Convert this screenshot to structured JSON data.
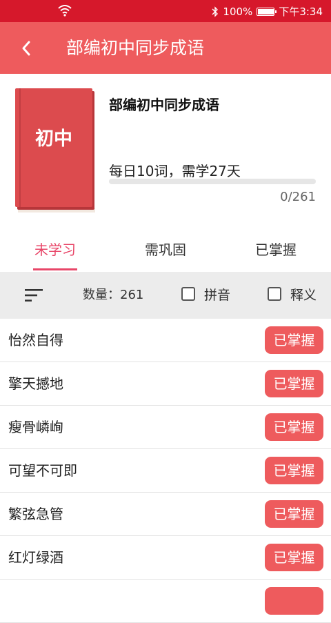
{
  "status_bar": {
    "battery_percent": "100%",
    "battery_level": 1.0,
    "time": "下午3:34"
  },
  "header": {
    "title": "部编初中同步成语"
  },
  "book": {
    "cover_text": "初中",
    "name": "部编初中同步成语",
    "plan": "每日10词，需学27天",
    "progress_label": "0/261",
    "progress_fraction": 0
  },
  "tabs": [
    {
      "label": "未学习",
      "active": true
    },
    {
      "label": "需巩固",
      "active": false
    },
    {
      "label": "已掌握",
      "active": false
    }
  ],
  "filter": {
    "count_label": "数量：261",
    "pinyin_label": "拼音",
    "pinyin_checked": false,
    "meaning_label": "释义",
    "meaning_checked": false
  },
  "list": {
    "button_label": "已掌握",
    "items": [
      "怡然自得",
      "擎天撼地",
      "瘦骨嶙峋",
      "可望不可即",
      "繁弦急管",
      "红灯绿酒",
      ""
    ]
  },
  "colors": {
    "status_bar": "#d6182b",
    "title_bar": "#ee5b5d",
    "accent_tab": "#e84668",
    "button": "#ee5b5d"
  }
}
